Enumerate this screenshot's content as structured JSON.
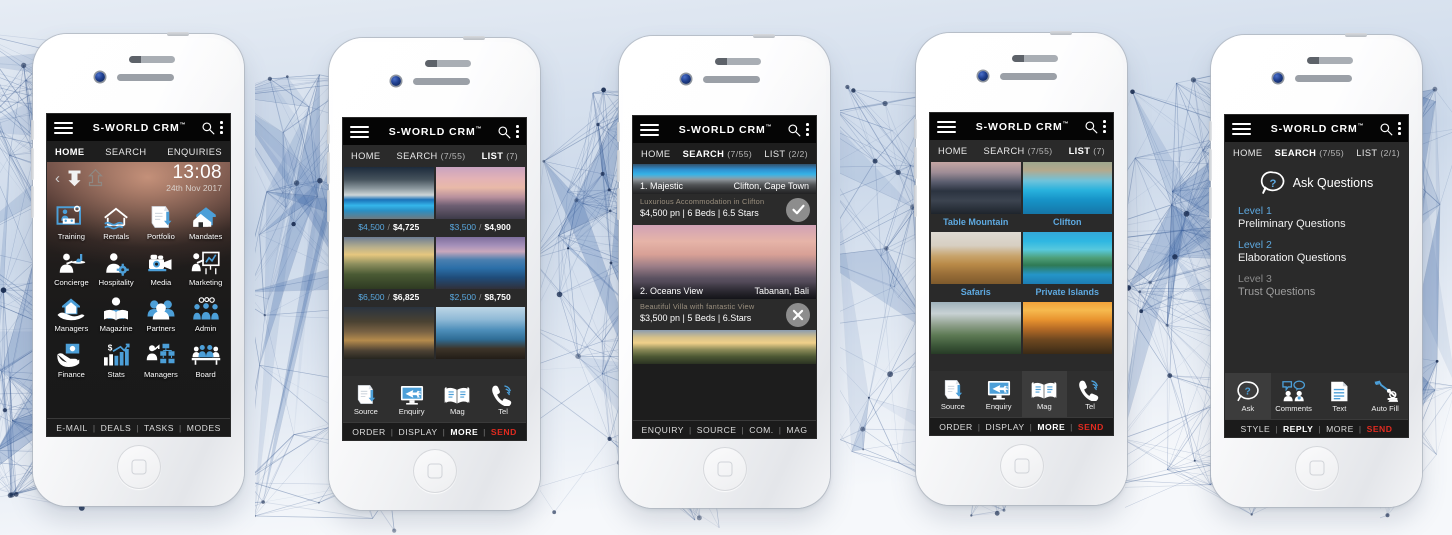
{
  "app": {
    "brand": "S-WORLD CRM",
    "trademark": "™",
    "icons": {
      "menu": "hamburger-menu-icon",
      "search": "search-icon",
      "overflow": "kebab-menu-icon"
    }
  },
  "background": {
    "description": "low-poly network mesh graphic",
    "gradient_from": "#e9edf3",
    "gradient_to": "#f7f9fb",
    "mesh_color": "#3a5a8c"
  },
  "phones": [
    {
      "id": "phone-home",
      "nav": [
        {
          "label": "HOME",
          "active": true
        },
        {
          "label": "SEARCH",
          "active": false
        },
        {
          "label": "ENQUIRIES",
          "active": false
        }
      ],
      "clock": {
        "back_icon": "chevron-left-icon",
        "download_icon": "download-arrow-icon",
        "upload_icon": "upload-arrow-icon",
        "time": "13:08",
        "date": "24th Nov 2017"
      },
      "grid": [
        {
          "label": "Training",
          "icon": "training-presenter-icon"
        },
        {
          "label": "Rentals",
          "icon": "house-water-icon"
        },
        {
          "label": "Portfolio",
          "icon": "document-upload-icon"
        },
        {
          "label": "Mandates",
          "icon": "two-houses-icon"
        },
        {
          "label": "Concierge",
          "icon": "waiter-tray-icon"
        },
        {
          "label": "Hospitality",
          "icon": "hostess-gear-icon"
        },
        {
          "label": "Media",
          "icon": "video-camera-icon"
        },
        {
          "label": "Marketing",
          "icon": "presenter-chart-icon"
        },
        {
          "label": "Managers",
          "icon": "hand-house-icon"
        },
        {
          "label": "Magazine",
          "icon": "reader-book-icon"
        },
        {
          "label": "Partners",
          "icon": "people-group-icon"
        },
        {
          "label": "Admin",
          "icon": "admin-people-gears-icon"
        },
        {
          "label": "Finance",
          "icon": "hand-money-icon"
        },
        {
          "label": "Stats",
          "icon": "bar-chart-dollar-icon"
        },
        {
          "label": "Managers",
          "icon": "org-chart-person-icon"
        },
        {
          "label": "Board",
          "icon": "boardroom-table-icon"
        }
      ],
      "footer": [
        "E-MAIL",
        "DEALS",
        "TASKS",
        "MODES"
      ]
    },
    {
      "id": "phone-search-prices",
      "nav": [
        {
          "label": "HOME",
          "active": false
        },
        {
          "label": "SEARCH",
          "count": "(7/55)",
          "active": false
        },
        {
          "label": "LIST",
          "count": "(7)",
          "active": true
        }
      ],
      "tiles": [
        {
          "price_a": "$4,500",
          "price_b": "$4,725",
          "image": "modern-villa-pool-night"
        },
        {
          "price_a": "$3,500",
          "price_b": "$4,900",
          "image": "pink-sunset-lagoon"
        },
        {
          "price_a": "$6,500",
          "price_b": "$6,825",
          "image": "tuscan-hillside-sunset"
        },
        {
          "price_a": "$2,500",
          "price_b": "$8,750",
          "image": "infinity-pool-daybed"
        },
        {
          "price_a": "",
          "price_b": "",
          "image": "bali-lodge-evening"
        },
        {
          "price_a": "",
          "price_b": "",
          "image": "tropical-beach-hut"
        }
      ],
      "tools": [
        {
          "label": "Source",
          "icon": "document-upload-icon"
        },
        {
          "label": "Enquiry",
          "icon": "monitor-plane-icon"
        },
        {
          "label": "Mag",
          "icon": "open-book-icon"
        },
        {
          "label": "Tel",
          "icon": "phone-signal-icon"
        }
      ],
      "footer": [
        "ORDER",
        "DISPLAY",
        "MORE",
        "SEND"
      ],
      "footer_bold": "MORE",
      "footer_send": "SEND"
    },
    {
      "id": "phone-listings",
      "nav": [
        {
          "label": "HOME",
          "active": false
        },
        {
          "label": "SEARCH",
          "count": "(7/55)",
          "active": true
        },
        {
          "label": "LIST",
          "count": "(2/2)",
          "active": false
        }
      ],
      "listings": [
        {
          "index": "1. Majestic",
          "location": "Clifton, Cape Town",
          "subtitle": "Luxurious Accommodation in Clifton",
          "meta": "$4,500 pn | 6 Beds | 6.5 Stars",
          "badge": "check-icon",
          "image": "clifton-pool-deck"
        },
        {
          "index": "2. Oceans View",
          "location": "Tabanan, Bali",
          "subtitle": "Beautiful Villa with fantastic View",
          "meta": "$3,500 pn | 5 Beds | 6.Stars",
          "badge": "close-icon",
          "image": "bali-pink-sunset-lagoon"
        },
        {
          "index": "",
          "location": "",
          "subtitle": "",
          "meta": "",
          "badge": "",
          "image": "tuscan-sunset-village"
        }
      ],
      "footer": [
        "ENQUIRY",
        "SOURCE",
        "COM.",
        "MAG"
      ]
    },
    {
      "id": "phone-destinations",
      "nav": [
        {
          "label": "HOME",
          "active": false
        },
        {
          "label": "SEARCH",
          "count": "(7/55)",
          "active": false
        },
        {
          "label": "LIST",
          "count": "(7)",
          "active": true
        }
      ],
      "tiles": [
        {
          "name": "Table Mountain",
          "image": "table-mountain-dusk"
        },
        {
          "name": "Clifton",
          "image": "clifton-beach-aerial"
        },
        {
          "name": "Safaris",
          "image": "running-cheetah"
        },
        {
          "name": "Private Islands",
          "image": "tropical-island-aerial"
        },
        {
          "name": "",
          "image": "victoria-falls"
        },
        {
          "name": "",
          "image": "savanna-sunset"
        }
      ],
      "tools": [
        {
          "label": "Source",
          "icon": "document-upload-icon"
        },
        {
          "label": "Enquiry",
          "icon": "monitor-plane-icon"
        },
        {
          "label": "Mag",
          "icon": "open-book-icon"
        },
        {
          "label": "Tel",
          "icon": "phone-signal-icon"
        }
      ],
      "footer": [
        "ORDER",
        "DISPLAY",
        "MORE",
        "SEND"
      ],
      "footer_bold": "MORE",
      "footer_send": "SEND"
    },
    {
      "id": "phone-questions",
      "nav": [
        {
          "label": "HOME",
          "active": false
        },
        {
          "label": "SEARCH",
          "count": "(7/55)",
          "active": true
        },
        {
          "label": "LIST",
          "count": "(2/1)",
          "active": false
        }
      ],
      "heading": {
        "icon": "question-bubble-icon",
        "title": "Ask Questions"
      },
      "levels": [
        {
          "level": "Level 1",
          "name": "Preliminary Questions",
          "enabled": true
        },
        {
          "level": "Level 2",
          "name": "Elaboration Questions",
          "enabled": true
        },
        {
          "level": "Level 3",
          "name": "Trust Questions",
          "enabled": false
        }
      ],
      "tools": [
        {
          "label": "Ask",
          "icon": "question-bubble-icon"
        },
        {
          "label": "Comments",
          "icon": "two-people-speech-icon"
        },
        {
          "label": "Text",
          "icon": "document-lines-icon"
        },
        {
          "label": "Auto Fill",
          "icon": "robot-arm-icon"
        }
      ],
      "footer": [
        "STYLE",
        "REPLY",
        "MORE",
        "SEND"
      ],
      "footer_bold": "REPLY",
      "footer_send": "SEND"
    }
  ]
}
